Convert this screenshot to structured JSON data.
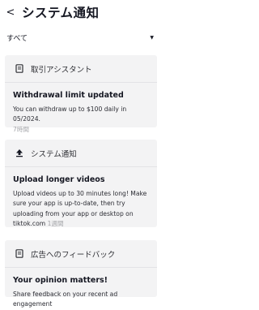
{
  "header": {
    "back_glyph": "<",
    "title": "システム通知"
  },
  "filter": {
    "selected": "すべて"
  },
  "cards": [
    {
      "category": "取引アシスタント",
      "icon": "document-icon",
      "title": "Withdrawal limit updated",
      "body": "You can withdraw up to $100 daily in 05/2024.",
      "time": "7時間"
    },
    {
      "category": "システム通知",
      "icon": "upload-icon",
      "title": "Upload longer videos",
      "body": "Upload videos up to 30 minutes long! Make sure your app is up-to-date, then try uploading from your app or desktop on tiktok.com",
      "time": "1週間"
    },
    {
      "category": "広告へのフィードバック",
      "icon": "feedback-icon",
      "title": "Your opinion matters!",
      "body": "Share feedback on your recent ad engagement"
    }
  ]
}
